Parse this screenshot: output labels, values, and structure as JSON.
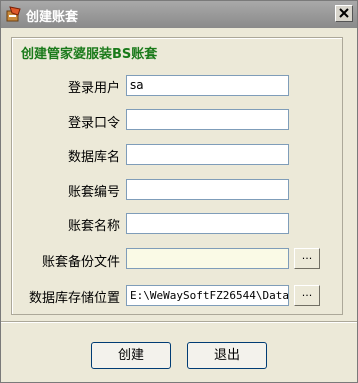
{
  "window": {
    "title": "创建账套",
    "icon": "app-icon",
    "close_icon": "close-icon"
  },
  "form": {
    "heading": "创建管家婆服装BS账套",
    "fields": [
      {
        "label": "登录用户",
        "value": "sa"
      },
      {
        "label": "登录口令",
        "value": ""
      },
      {
        "label": "数据库名",
        "value": ""
      },
      {
        "label": "账套编号",
        "value": ""
      },
      {
        "label": "账套名称",
        "value": ""
      },
      {
        "label": "账套备份文件",
        "value": "",
        "browse": "..."
      },
      {
        "label": "数据库存储位置",
        "value": "E:\\WeWaySoftFZ26544\\Data",
        "browse": "..."
      }
    ]
  },
  "buttons": {
    "create": "创建",
    "exit": "退出"
  }
}
